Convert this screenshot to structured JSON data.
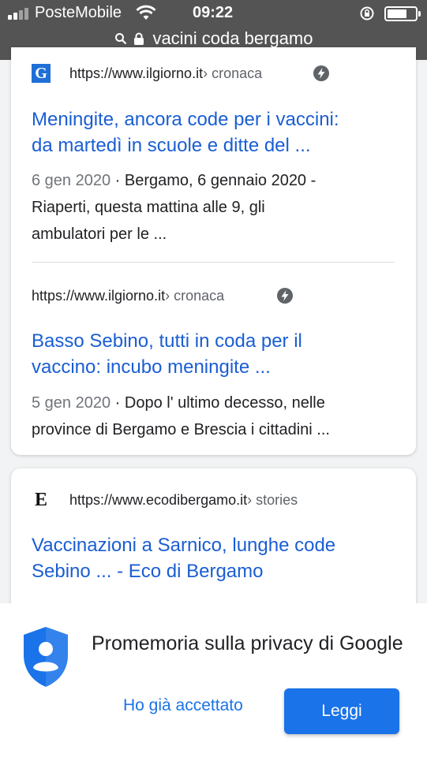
{
  "status_bar": {
    "carrier": "PosteMobile",
    "time": "09:22",
    "battery_level": 0.62
  },
  "address_bar": {
    "query": "vacini coda bergamo"
  },
  "results": [
    {
      "favicon_letter": "G",
      "url": "https://www.ilgiorno.it",
      "breadcrumb": " › cronaca",
      "title_line1": "Meningite, ancora code per i vaccini:",
      "title_line2": "da martedì in scuole e ditte del ...",
      "date": "6 gen 2020",
      "snippet_line1_rest": " · Bergamo, 6 gennaio 2020 -",
      "snippet_line2": "Riaperti, questa mattina alle 9, gli",
      "snippet_line3": "ambulatori per le ..."
    },
    {
      "url": "https://www.ilgiorno.it",
      "breadcrumb": " › cronaca",
      "title_line1": "Basso Sebino, tutti in coda per il",
      "title_line2": "vaccino: incubo meningite ...",
      "date": "5 gen 2020",
      "snippet_line1_rest": " · Dopo l' ultimo decesso, nelle",
      "snippet_line2": "province di Bergamo e Brescia i cittadini ..."
    },
    {
      "favicon_letter": "E",
      "url": "https://www.ecodibergamo.it",
      "breadcrumb": " › stories",
      "title_line1": "Vaccinazioni a Sarnico, lunghe code",
      "title_line2": "Sebino ... - Eco di Bergamo"
    }
  ],
  "privacy_banner": {
    "message": "Promemoria sulla privacy di Google",
    "accepted_label": "Ho già accettato",
    "read_label": "Leggi"
  },
  "colors": {
    "link_blue": "#1a5ed3",
    "button_blue": "#1a73e8",
    "toolbar_gray": "#545454"
  }
}
